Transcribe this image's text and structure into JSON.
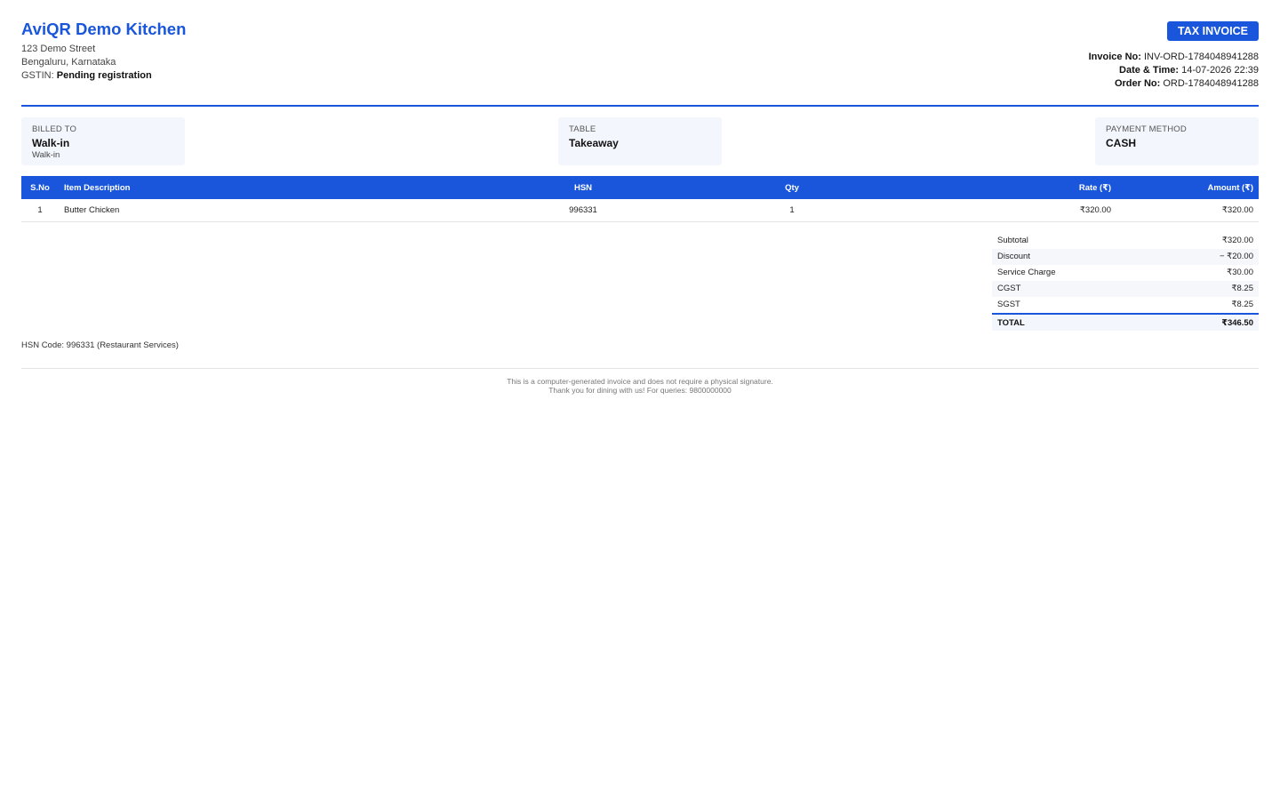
{
  "business": {
    "name": "AviQR Demo Kitchen",
    "address_line1": "123 Demo Street",
    "address_line2": "Bengaluru, Karnataka",
    "gstin_label": "GSTIN:",
    "gstin_value": "Pending registration"
  },
  "invoice": {
    "badge": "TAX INVOICE",
    "invoice_no_label": "Invoice No:",
    "invoice_no": "INV-ORD-1784048941288",
    "datetime_label": "Date & Time:",
    "datetime": "14-07-2026 22:39",
    "order_no_label": "Order No:",
    "order_no": "ORD-1784048941288"
  },
  "info": {
    "billed_to": {
      "label": "BILLED TO",
      "value": "Walk-in",
      "sub": "Walk-in"
    },
    "table": {
      "label": "TABLE",
      "value": "Takeaway"
    },
    "payment": {
      "label": "PAYMENT METHOD",
      "value": "CASH"
    }
  },
  "items_table": {
    "headers": {
      "sno": "S.No",
      "desc": "Item Description",
      "hsn": "HSN",
      "qty": "Qty",
      "rate": "Rate (₹)",
      "amount": "Amount (₹)"
    },
    "rows": [
      {
        "sno": "1",
        "desc": "Butter Chicken",
        "hsn": "996331",
        "qty": "1",
        "rate": "₹320.00",
        "amount": "₹320.00"
      }
    ]
  },
  "totals": {
    "subtotal_label": "Subtotal",
    "subtotal": "₹320.00",
    "discount_label": "Discount",
    "discount": "− ₹20.00",
    "service_label": "Service Charge",
    "service": "₹30.00",
    "cgst_label": "CGST",
    "cgst": "₹8.25",
    "sgst_label": "SGST",
    "sgst": "₹8.25",
    "total_label": "TOTAL",
    "total": "₹346.50"
  },
  "hsn_note": "HSN Code: 996331 (Restaurant Services)",
  "footer": {
    "line1": "This is a computer-generated invoice and does not require a physical signature.",
    "line2": "Thank you for dining with us! For queries: 9800000000"
  },
  "colors": {
    "accent": "#1a56db",
    "panel": "#f3f6fd"
  }
}
